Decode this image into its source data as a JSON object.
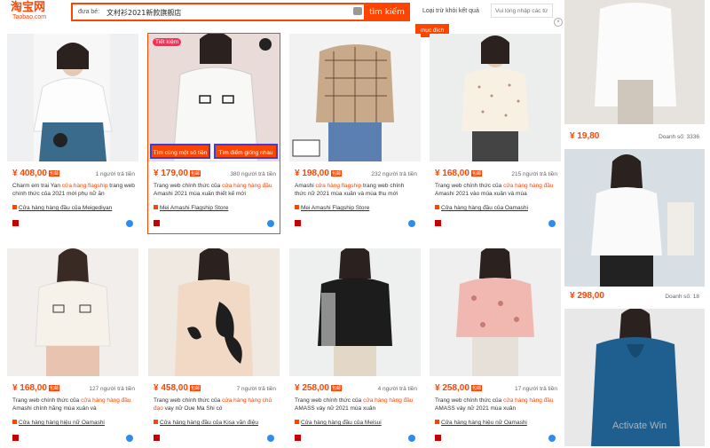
{
  "logo": {
    "cn": "淘宝网",
    "en": "Taobao.com"
  },
  "search": {
    "label": "đưa bé:",
    "query": "文村衫2021新款旗舰店",
    "button": "tìm kiếm",
    "camera": "camera-icon"
  },
  "filter": {
    "exclude_label": "Loại trừ khỏi kết quả",
    "exclude_placeholder": "Vui lòng nhập các từ cần",
    "purpose": "mục đích"
  },
  "products": [
    {
      "price": "¥ 408,00",
      "sold": "1 người trả tiền",
      "title_pre": "Charm em trai Yan ",
      "title_hl": "cửa hàng flagship",
      "title_post": " trang web chính thức của 2021 mới phụ nữ ăn",
      "shop": "Cửa hàng hàng đầu của Meigediyan"
    },
    {
      "price": "¥ 179,00",
      "sold": "380 người trả tiền",
      "title_pre": "Trang web chính thức của ",
      "title_hl": "cửa hàng hàng đầu",
      "title_post": " Amashi 2021 mùa xuân thiết kế mới",
      "shop": "Mei Amashi Flagship Store",
      "tag": "Tiết kiệm",
      "btn_same": "Tìm cùng một số tiền",
      "btn_similar": "Tìm điểm giống nhau"
    },
    {
      "price": "¥ 198,00",
      "sold": "232 người trả tiền",
      "title_pre": "Amashi ",
      "title_hl": "cửa hàng flagship",
      "title_post": " trang web chính thức nữ 2021 mùa xuân và mùa thu mới",
      "shop": "Mei Amashi Flagship Store"
    },
    {
      "price": "¥ 168,00",
      "sold": "215 người trả tiền",
      "title_pre": "Trang web chính thức của ",
      "title_hl": "cửa hàng hàng đầu",
      "title_post": " Amashi 2021 vào mùa xuân và mùa",
      "shop": "Cửa hàng hàng đầu của Oamashi"
    },
    {
      "price": "¥ 168,00",
      "sold": "127 người trả tiền",
      "title_pre": "Trang web chính thức của ",
      "title_hl": "cửa hàng hàng đầu",
      "title_post": " Amashi chính hãng mùa xuân và",
      "shop": "Cửa hàng hàng hiệu nữ Oamashi"
    },
    {
      "price": "¥ 458,00",
      "sold": "7 người trả tiền",
      "title_pre": "Trang web chính thức của ",
      "title_hl": "cửa hàng hàng chủ đạo",
      "title_post": " vay nữ Oue Ma Shi có",
      "shop": "Cửa hàng hàng đầu của Kisa văn điệu"
    },
    {
      "price": "¥ 258,00",
      "sold": "4 người trả tiền",
      "title_pre": "Trang web chính thức của ",
      "title_hl": "cửa hàng hàng đầu",
      "title_post": " AMASS váy nữ 2021 mùa xuân",
      "shop": "Cửa hàng hàng đầu của Meisui"
    },
    {
      "price": "¥ 258,00",
      "sold": "17 người trả tiền",
      "title_pre": "Trang web chính thức của ",
      "title_hl": "cửa hàng hàng đầu",
      "title_post": " AMASS váy nữ 2021 mùa xuân",
      "shop": "Cửa hàng hàng hiệu nữ Oamashi"
    }
  ],
  "side": [
    {
      "price": "¥ 19,80",
      "sold": "Doanh số: 3336"
    },
    {
      "price": "¥ 298,00",
      "sold": "Doanh số: 18"
    }
  ],
  "watermark": "Activate Win"
}
